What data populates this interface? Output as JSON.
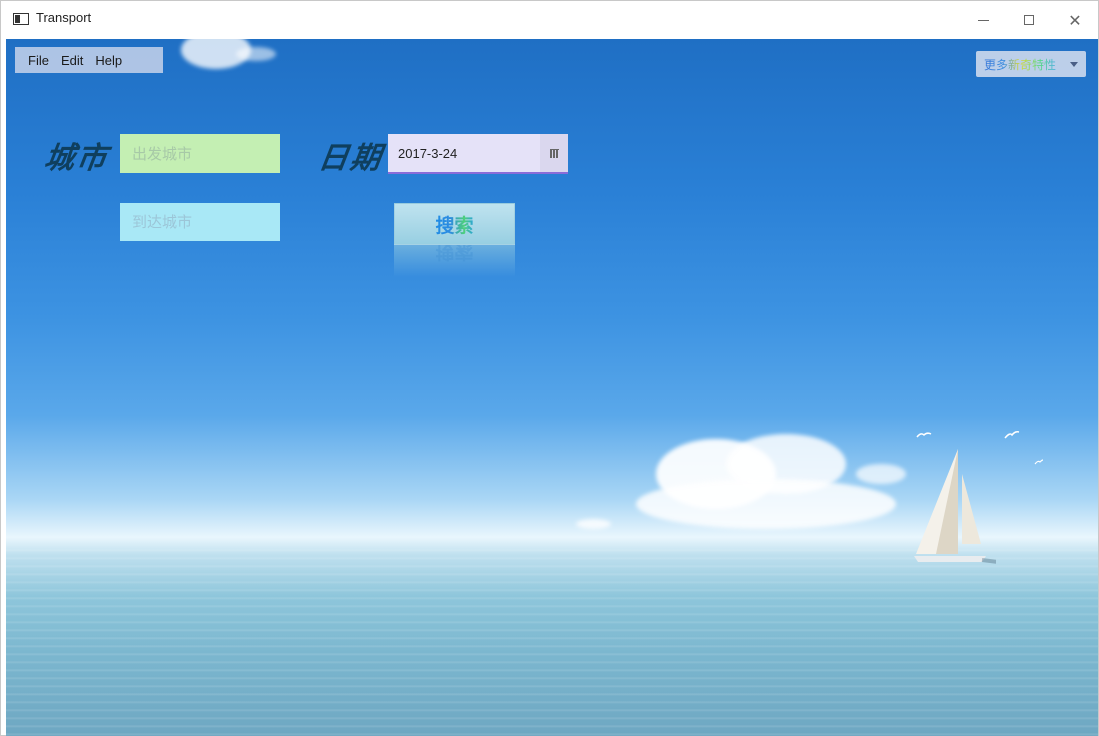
{
  "window": {
    "title": "Transport",
    "controls": [
      "minimize",
      "maximize",
      "close"
    ]
  },
  "menubar": {
    "items": [
      "File",
      "Edit",
      "Help"
    ]
  },
  "more_button": {
    "label": "更多新奇特性"
  },
  "form": {
    "city_label": "城市",
    "date_label": "日期",
    "depart_city": {
      "value": "",
      "placeholder": "出发城市"
    },
    "arrive_city": {
      "value": "",
      "placeholder": "到达城市"
    },
    "date": {
      "value": "2017-3-24"
    },
    "search_label": "搜索"
  },
  "colors": {
    "sky_top": "#1f6fc4",
    "depart_field": "#c4efb3",
    "arrive_field": "#a9e8f6",
    "datepicker_bg": "#e5e2f8",
    "datepicker_accent": "#8a6cd8",
    "label_color": "#0f3f5e"
  },
  "icons": [
    "app-window-icon",
    "calendar-icon",
    "dropdown-caret-icon"
  ]
}
